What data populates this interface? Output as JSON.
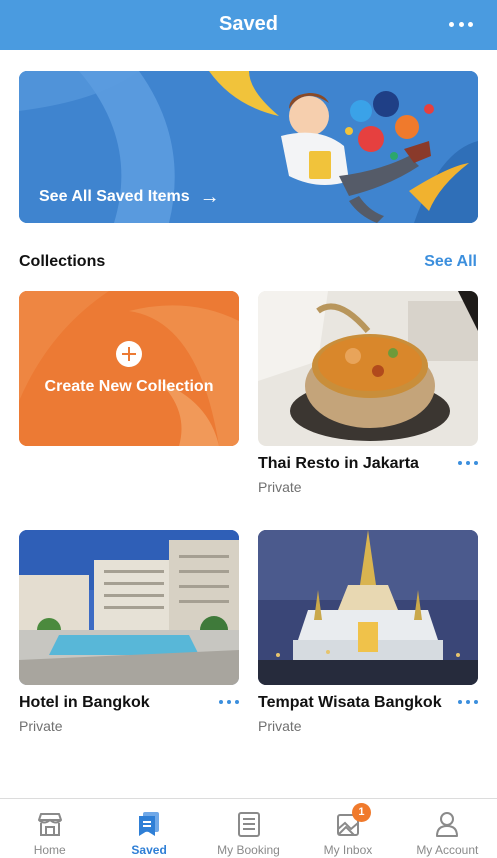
{
  "header": {
    "title": "Saved",
    "more_icon": "more-horizontal-icon"
  },
  "banner": {
    "label": "See All Saved Items",
    "arrow_icon": "arrow-right-icon"
  },
  "collections": {
    "title": "Collections",
    "see_all": "See All",
    "create_label": "Create New Collection",
    "items": [
      {
        "title": "Thai Resto in Jakarta",
        "privacy": "Private"
      },
      {
        "title": "Hotel in Bangkok",
        "privacy": "Private"
      },
      {
        "title": "Tempat Wisata Bangkok",
        "privacy": "Private"
      }
    ]
  },
  "tabs": [
    {
      "label": "Home",
      "icon": "home-store-icon"
    },
    {
      "label": "Saved",
      "icon": "bookmark-icon",
      "active": true
    },
    {
      "label": "My Booking",
      "icon": "booking-icon"
    },
    {
      "label": "My Inbox",
      "icon": "inbox-icon",
      "badge": "1"
    },
    {
      "label": "My Account",
      "icon": "account-icon"
    }
  ],
  "colors": {
    "header": "#4a9be0",
    "accent": "#3c8fdd",
    "create_card": "#ec7a34",
    "badge": "#f07a2c"
  }
}
